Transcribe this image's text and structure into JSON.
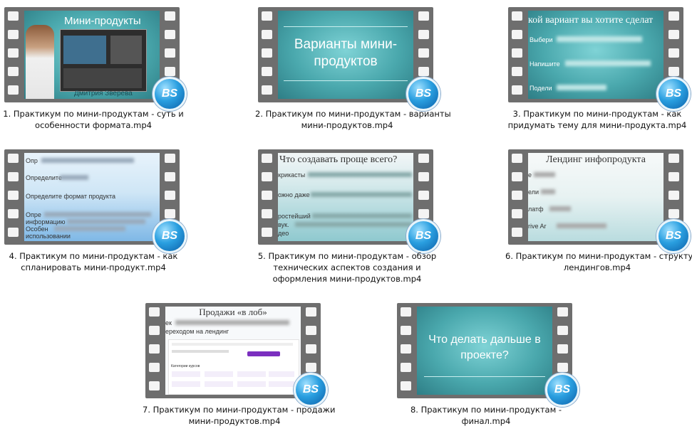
{
  "items": [
    {
      "caption_lines": [
        "1. Практикум по мини-продуктам - суть и",
        "особенности формата.mp4"
      ],
      "slide_title": "Мини-продукты",
      "slide_subtitle": "Дмитрия Зверева"
    },
    {
      "caption_lines": [
        "2. Практикум по мини-продуктам - варианты",
        "мини-продуктов.mp4"
      ],
      "slide_title": "Варианты мини-продуктов"
    },
    {
      "caption_lines": [
        "3. Практикум по мини-продуктам - как",
        "придумать тему для мини-продукта.mp4"
      ],
      "slide_title": "кой вариант вы хотите сделат",
      "slide_lines": [
        "Выбери",
        "Напишите",
        "Подели"
      ]
    },
    {
      "caption_lines": [
        "4. Практикум по мини-продуктам - как",
        "спланировать мини-продукт.mp4"
      ],
      "slide_lines": [
        "Опр",
        "Определите",
        "Определите формат продукта",
        "Опре",
        "информацию",
        "Особен",
        "использовании"
      ]
    },
    {
      "caption_lines": [
        "5. Практикум по мини-продуктам - обзор",
        "технических аспектов создания и",
        "оформления мини-продуктов.mp4"
      ],
      "slide_title": "Что создавать проще всего?",
      "slide_lines": [
        "крикасты",
        "ожно даже",
        "ростейший",
        "вук.",
        "део"
      ]
    },
    {
      "caption_lines": [
        "6. Практикум по мини-продуктам - структура",
        "лендингов.mp4"
      ],
      "slide_title": "Лендинг инфопродукта",
      "slide_lines": [
        "е",
        "ели",
        "латф",
        "rive Ar"
      ]
    },
    {
      "caption_lines": [
        "7. Практикум по мини-продуктам - продажи",
        "мини-продуктов.mp4"
      ],
      "slide_title": "Продажи «в лоб»",
      "slide_lines": [
        "ек",
        "ереходом на лендинг"
      ],
      "slide_section": "Категории курсов"
    },
    {
      "caption_lines": [
        "8. Практикум по мини-продуктам -",
        "финал.mp4"
      ],
      "slide_title": "Что делать дальше в проекте?"
    }
  ],
  "badge_text": "BS",
  "icons": {
    "badge": "bs-player-badge-icon",
    "film": "film-strip-icon"
  }
}
